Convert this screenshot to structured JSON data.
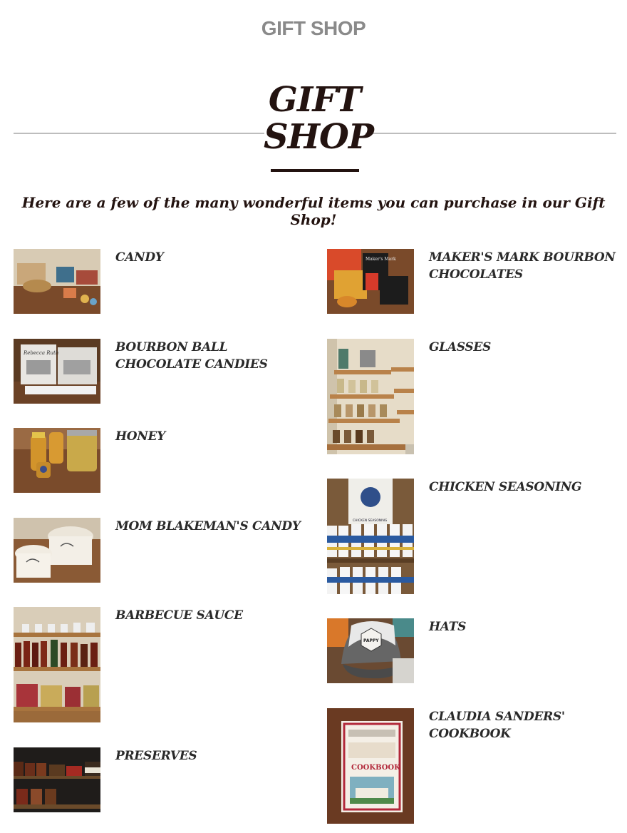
{
  "header": {
    "title": "GIFT SHOP"
  },
  "hero": {
    "title_line1": "GIFT",
    "title_line2": "SHOP",
    "tagline": "Here are a few of the many wonderful items you can purchase in our Gift Shop!"
  },
  "left_items": [
    {
      "label": "CANDY"
    },
    {
      "label": "BOURBON BALL CHOCOLATE CANDIES"
    },
    {
      "label": "HONEY"
    },
    {
      "label": "MOM BLAKEMAN'S CANDY"
    },
    {
      "label": "BARBECUE SAUCE"
    },
    {
      "label": "PRESERVES"
    }
  ],
  "right_items": [
    {
      "label": "MAKER'S MARK BOURBON CHOCOLATES"
    },
    {
      "label": "GLASSES"
    },
    {
      "label": "CHICKEN SEASONING"
    },
    {
      "label": "HATS"
    },
    {
      "label": "CLAUDIA SANDERS' COOKBOOK"
    }
  ],
  "photo_text": {
    "bourbon_box": "Rebecca Ruth",
    "makers_box": "Maker's Mark",
    "seasoning": "CHICKEN SEASONING",
    "hat_badge": "PAPPY",
    "cookbook_title": "COOKBOOK"
  },
  "colors": {
    "heading": "#231310",
    "header_gray": "#8a8a8a",
    "rule": "#bdbdbd"
  }
}
